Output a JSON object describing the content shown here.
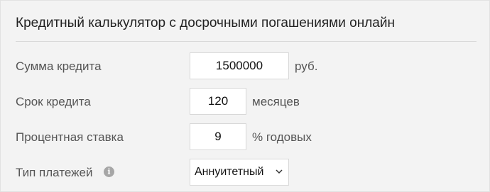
{
  "calculator": {
    "title": "Кредитный калькулятор с досрочными погашениями онлайн",
    "amount": {
      "label": "Сумма кредита",
      "value": "1500000",
      "unit": "руб."
    },
    "term": {
      "label": "Срок кредита",
      "value": "120",
      "unit": "месяцев"
    },
    "rate": {
      "label": "Процентная ставка",
      "value": "9",
      "unit": "% годовых"
    },
    "payment_type": {
      "label": "Тип платежей",
      "info_icon": "i",
      "selected": "Аннуитетный"
    }
  },
  "icons": {
    "info": "info-icon",
    "dropdown": "chevron-down-icon"
  },
  "colors": {
    "panel_background": "#f3f3f3",
    "field_background": "#ffffff",
    "label_text": "#555555",
    "title_text": "#222222"
  }
}
